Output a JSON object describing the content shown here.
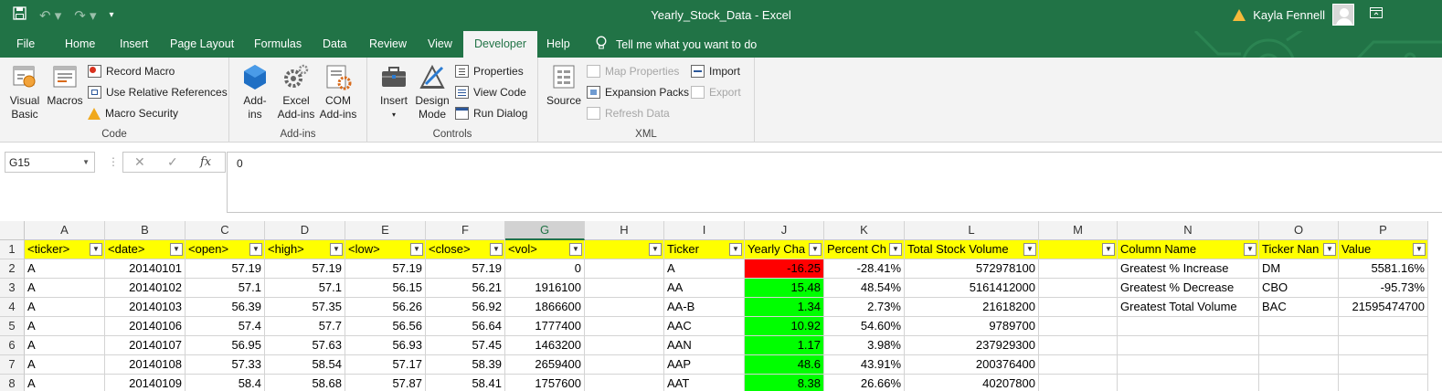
{
  "window": {
    "title": "Yearly_Stock_Data  -  Excel",
    "user": "Kayla Fennell"
  },
  "tabs": [
    "File",
    "Home",
    "Insert",
    "Page Layout",
    "Formulas",
    "Data",
    "Review",
    "View",
    "Developer",
    "Help"
  ],
  "tell_me": "Tell me what you want to do",
  "ribbon": {
    "code": {
      "label": "Code",
      "visual_basic": "Visual\nBasic",
      "macros": "Macros",
      "record_macro": "Record Macro",
      "relative_refs": "Use Relative References",
      "macro_security": "Macro Security"
    },
    "addins": {
      "label": "Add-ins",
      "addins": "Add-\nins",
      "excel_addins": "Excel\nAdd-ins",
      "com_addins": "COM\nAdd-ins"
    },
    "controls": {
      "label": "Controls",
      "insert": "Insert",
      "design_mode": "Design\nMode",
      "properties": "Properties",
      "view_code": "View Code",
      "run_dialog": "Run Dialog"
    },
    "xml": {
      "label": "XML",
      "source": "Source",
      "map_properties": "Map Properties",
      "expansion_packs": "Expansion Packs",
      "refresh_data": "Refresh Data",
      "import": "Import",
      "export": "Export"
    }
  },
  "formula_bar": {
    "name_box": "G15",
    "formula": "0"
  },
  "sheet": {
    "columns": [
      "A",
      "B",
      "C",
      "D",
      "E",
      "F",
      "G",
      "H",
      "I",
      "J",
      "K",
      "L",
      "M",
      "N",
      "O",
      "P"
    ],
    "selected_column": "G",
    "rows": [
      "1",
      "2",
      "3",
      "4",
      "5",
      "6",
      "7",
      "8"
    ],
    "header_row": [
      "<ticker>",
      "<date>",
      "<open>",
      "<high>",
      "<low>",
      "<close>",
      "<vol>",
      "",
      "Ticker",
      "Yearly Cha",
      "Percent Ch",
      "Total Stock Volume",
      "",
      "Column Name",
      "Ticker Nan",
      "Value"
    ],
    "data": [
      [
        "A",
        "20140101",
        "57.19",
        "57.19",
        "57.19",
        "57.19",
        "0",
        "",
        "A",
        "-16.25",
        "-28.41%",
        "572978100",
        "",
        "Greatest % Increase",
        "DM",
        "5581.16%"
      ],
      [
        "A",
        "20140102",
        "57.1",
        "57.1",
        "56.15",
        "56.21",
        "1916100",
        "",
        "AA",
        "15.48",
        "48.54%",
        "5161412000",
        "",
        "Greatest % Decrease",
        "CBO",
        "-95.73%"
      ],
      [
        "A",
        "20140103",
        "56.39",
        "57.35",
        "56.26",
        "56.92",
        "1866600",
        "",
        "AA-B",
        "1.34",
        "2.73%",
        "21618200",
        "",
        "Greatest Total Volume",
        "BAC",
        "21595474700"
      ],
      [
        "A",
        "20140106",
        "57.4",
        "57.7",
        "56.56",
        "56.64",
        "1777400",
        "",
        "AAC",
        "10.92",
        "54.60%",
        "9789700",
        "",
        "",
        "",
        ""
      ],
      [
        "A",
        "20140107",
        "56.95",
        "57.63",
        "56.93",
        "57.45",
        "1463200",
        "",
        "AAN",
        "1.17",
        "3.98%",
        "237929300",
        "",
        "",
        "",
        ""
      ],
      [
        "A",
        "20140108",
        "57.33",
        "58.54",
        "57.17",
        "58.39",
        "2659400",
        "",
        "AAP",
        "48.6",
        "43.91%",
        "200376400",
        "",
        "",
        "",
        ""
      ],
      [
        "A",
        "20140109",
        "58.4",
        "58.68",
        "57.87",
        "58.41",
        "1757600",
        "",
        "AAT",
        "8.38",
        "26.66%",
        "40207800",
        "",
        "",
        "",
        ""
      ]
    ],
    "yearly_change_colors": [
      "#ff0000",
      "#00ff00",
      "#00ff00",
      "#00ff00",
      "#00ff00",
      "#00ff00",
      "#00ff00"
    ]
  }
}
